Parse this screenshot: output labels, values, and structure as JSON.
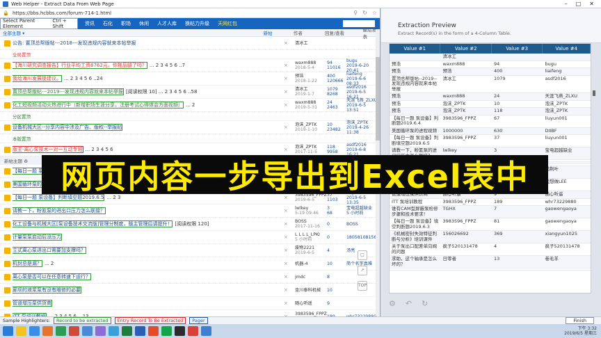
{
  "window": {
    "title": "Web Helper - Extract Data From Web Page"
  },
  "browser": {
    "url": "https://bbs.hcbbs.com/forum-714-1.html",
    "select_parent": "Select Parent Element",
    "shortcut": "Ctrl + Shift",
    "nav": [
      "资讯",
      "石化",
      "职场",
      "休闲",
      "人才人库",
      "换帖力升级",
      "天网红包"
    ],
    "quick_nav": "快捷导航 ▾",
    "header": {
      "title": "全部主题 ▾",
      "new": "新帖",
      "author": "作者",
      "replies": "回复/查看",
      "last": "最后发表"
    },
    "global_section": "全局置顶",
    "category_section": "分区置顶",
    "forum_section": "本版置顶",
    "new_threads": "新帖主题 ♻",
    "new_label": "New",
    "rows_top": [
      {
        "title": "公告: 置顶总帮版帖---2018---发现违规内容就来本帖举报",
        "style": "",
        "author": "清冰工",
        "date": "",
        "num": "",
        "views": "",
        "last": ""
      },
      {
        "title": "【海川研究调查报告】行业平均工资8762元，你拖后腿了吗？",
        "pages": "... 2 3 4 5 6 ..7",
        "style": "red",
        "author": "waxm888",
        "date": "2018-5-4",
        "num": "94",
        "views": "11016",
        "last": "bugu",
        "lastdate": "2019-6-20 20:41"
      },
      {
        "title": "我给海川发展提建议。",
        "pages": "... 2 3 4 5 6 ..24",
        "style": "red",
        "author": "预浩",
        "date": "2018-1-22",
        "num": "400",
        "views": "120666",
        "last": "liaifeng",
        "lastdate": "2019-6-6 08:33"
      },
      {
        "title": "置顶总帮版帖---2019---发现违规内容就来本帖举报",
        "pages": "[阅读权限 10] ... 2 3 4 5 6 ..58",
        "style": "green",
        "author": "清冰工",
        "date": "2019-1-7",
        "num": "1079",
        "views": "8268",
        "last": "asdf2016",
        "lastdate": "2019-6-5 16:21"
      },
      {
        "title": "化工短视频活动火热进行中（新增职场生涯分享，注册考试心得体会方面视频）",
        "pages": "... 2",
        "style": "green",
        "author": "waxm888",
        "date": "2019-5-31",
        "num": "24",
        "views": "2463",
        "last": "天涯飞燕_ZLXU",
        "lastdate": "2019-6-5 13:51"
      }
    ],
    "rows_cat": [
      {
        "title": "设备机械大区--分享内容中涉及广告、版权--举报贴",
        "style": "",
        "author": "泡沫_ZPTK",
        "date": "2019-1-10",
        "num": "10",
        "views": "23482",
        "last": "泡沫_ZPTK",
        "lastdate": "2019-4-26 11:38"
      }
    ],
    "rows_forum": [
      {
        "title": "版主-离心泵技术一对一互动专贴",
        "pages": "... 2 3 4 5 6",
        "style": "red",
        "author": "泡沫_ZPTK",
        "date": "2017-11-5",
        "num": "118",
        "views": "9958",
        "last": "asdf2016",
        "lastdate": "2019-6-8 16:21"
      }
    ],
    "rows_new": [
      {
        "title": "【每日一题 泵设备】判断泵空…",
        "pages": "... 2 3 4 5 6 ...",
        "author": "3983596_FPPZ",
        "date": "",
        "num": "67",
        "views": "",
        "last": "liuyun001",
        "lastdate": ""
      },
      {
        "title": "美国循环泵的进…",
        "pages": "",
        "author": "1000000",
        "date": "",
        "num": "630",
        "views": "",
        "last": "DIIBF",
        "lastdate": ""
      },
      {
        "title": "【每日一题 泵设备】判断填空题2019.6.5",
        "pages": "... 2 3",
        "author": "3983596_FPPZ",
        "date": "2019-6-5",
        "num": "37",
        "views": "1103",
        "last": "liuyun001",
        "lastdate": "2019-6-5 13:35"
      },
      {
        "title": "请教一下，粉氰泵的进出口压力怎么联接？",
        "pages": "",
        "author": "lwlkey",
        "date": "5-19 09:46",
        "num": "3",
        "views": "68",
        "last": "宝电超越缺业",
        "lastdate": "5 小时前"
      },
      {
        "title": "化工设备与机械大区[泵设备技术交流版]管理分制度，版主管理后请提升！",
        "pages": "[阅读权限 120]",
        "author": "BOSS",
        "date": "2017-11-16",
        "num": "0",
        "views": "",
        "last": "BOSS",
        "lastdate": ""
      },
      {
        "title": "计量泵泵启动后没压力",
        "pages": "",
        "author": "L L L L_LPKI",
        "date": "5 小时前",
        "num": "0",
        "views": "",
        "last": "18058108156",
        "lastdate": ""
      },
      {
        "title": "立式离心泵进出口需要加支撑吗？",
        "pages": "",
        "author": "废物2221",
        "date": "2019-6-5",
        "num": "4",
        "views": "",
        "last": "汤亮",
        "lastdate": ""
      },
      {
        "title": "机封总是漏？",
        "pages": "... 2",
        "author": "机器-4",
        "date": "",
        "num": "10",
        "views": "",
        "last": "简个名字真难",
        "lastdate": ""
      },
      {
        "title": "离心泵是否可以在任意转速下运行？",
        "pages": "",
        "author": "jmdc",
        "date": "",
        "num": "8",
        "views": "",
        "last": "",
        "lastdate": ""
      },
      {
        "title": "廊坝的液浆泵有没有维修的必要",
        "pages": "",
        "author": "金川泰科机械",
        "date": "",
        "num": "10",
        "views": "",
        "last": "",
        "lastdate": ""
      },
      {
        "title": "管道增压泵供货商",
        "pages": "",
        "author": "随心听遥",
        "date": "",
        "num": "9",
        "views": "",
        "last": "",
        "lastdate": ""
      },
      {
        "title": "ITT 泵培训教程",
        "pages": "... 2 3 4 5 6 ...13",
        "author": "3983596_FPPZ",
        "date": "2019-6-3",
        "num": "189",
        "views": "",
        "last": "whr73229880",
        "lastdate": ""
      }
    ]
  },
  "preview": {
    "title": "Extraction Preview",
    "subtitle": "Extract Record(s) in the form of a 4-Column Table.",
    "columns": [
      "Value #1",
      "Value #2",
      "Value #3",
      "Value #4"
    ],
    "rows": [
      [
        "",
        "清冰工",
        "",
        ""
      ],
      [
        "预浩",
        "waxm888",
        "94",
        "bugu"
      ],
      [
        "预浩",
        "预浩",
        "400",
        "liaifeng"
      ],
      [
        "置顶总帮版帖--2019--发现违规内容就来本帖举报",
        "清冰工",
        "1079",
        "asdf2016"
      ],
      [
        "预浩",
        "waxm888",
        "24",
        "天涯飞燕_ZLXU"
      ],
      [
        "预浩",
        "泡沫_ZPTK",
        "10",
        "泡沫_ZPTK"
      ],
      [
        "预浩",
        "泡沫_ZPTK",
        "118",
        "泡沫_ZPTK"
      ],
      [
        "【每日一题 泵设备】判断题2019.6.4",
        "3983596_FPPZ",
        "67",
        "liuyun001"
      ],
      [
        "美国循环泵的进程视频",
        "1000000",
        "630",
        "DIIBF"
      ],
      [
        "【每日一题 泵设备】判断填空题2019.6.5",
        "3983596_FPPZ",
        "37",
        "liuyun001"
      ],
      [
        "请教一下，粉氰泵的进出口压力怎么联接？",
        "lwlkey",
        "3",
        "宝电超越缺业"
      ],
      [
        "",
        "",
        "",
        ""
      ],
      [
        "",
        "",
        "",
        ""
      ],
      [
        "",
        "",
        "",
        ""
      ],
      [
        "离心泵是否可以在任意转速下运行?",
        "jmdc",
        "8",
        "槌荆叶"
      ],
      [
        "廊坝的液浆泵有没有维修的必要",
        "金川泰科机械",
        "10",
        "我想做LEE"
      ],
      [
        "管道增压泵供货商",
        "随心听遥",
        "9",
        "随心听遥"
      ],
      [
        "ITT 泵培训教程",
        "3983596_FPPZ",
        "189",
        "whr73229880"
      ],
      [
        "谁有CAM型屏蔽泵检修步骤和技术要求！",
        "TGHX",
        "7",
        "gaowengaoya"
      ],
      [
        "【每日一题 泵设备】填空判断题2019.6.3",
        "3983596_FPPZ",
        "81",
        "gaowengaoya"
      ],
      [
        "《机械密封失效特征判断与分析》培训课件",
        "156026692",
        "369",
        "xiangyun1025"
      ],
      [
        "关于泵出口配差单向阀的问题",
        "疯子520131478",
        "4",
        "疯子520131478"
      ],
      [
        "求助，这个轴承是怎么坏的？",
        "日零者",
        "13",
        "卷毛羊"
      ],
      [
        "",
        "",
        "",
        ""
      ]
    ]
  },
  "overlay_text": "网页内容一步导出到Excel表中",
  "status": {
    "label": "Sample Highlighters:",
    "extracted": "Record to be extracted",
    "not_extracted": "Entry Record To Be Extracted",
    "pager": "Pager",
    "finish": "Finish"
  },
  "clock": {
    "time": "下午 3:32",
    "date": "2019/6/5 星期三"
  }
}
